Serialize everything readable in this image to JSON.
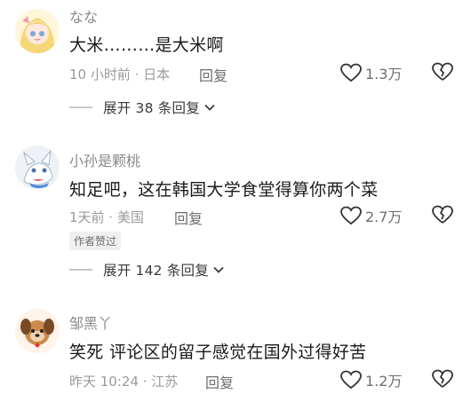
{
  "comments": [
    {
      "username": "なな",
      "text": "大米………是大米啊",
      "time_location": "10 小时前 · 日本",
      "reply_label": "回复",
      "likes": "1.3万",
      "expand_label": "展开 38 条回复"
    },
    {
      "username": "小孙是颗桃",
      "text": "知足吧，这在韩国大学食堂得算你两个菜",
      "time_location": "1天前 · 美国",
      "reply_label": "回复",
      "likes": "2.7万",
      "badge": "作者赞过",
      "expand_label": "展开 142 条回复"
    },
    {
      "username": "邹黑丫",
      "text": "笑死  评论区的留子感觉在国外过得好苦",
      "time_location": "昨天 10:24 · 江苏",
      "reply_label": "回复",
      "likes": "1.2万"
    }
  ],
  "icons": {
    "like": "heart-outline-icon",
    "dislike": "broken-heart-icon",
    "expand": "chevron-down-icon"
  },
  "colors": {
    "username": "#8a8a8a",
    "meta": "#9a9a9a",
    "text": "#1a1a1a",
    "badge_bg": "#f0f0f0"
  }
}
